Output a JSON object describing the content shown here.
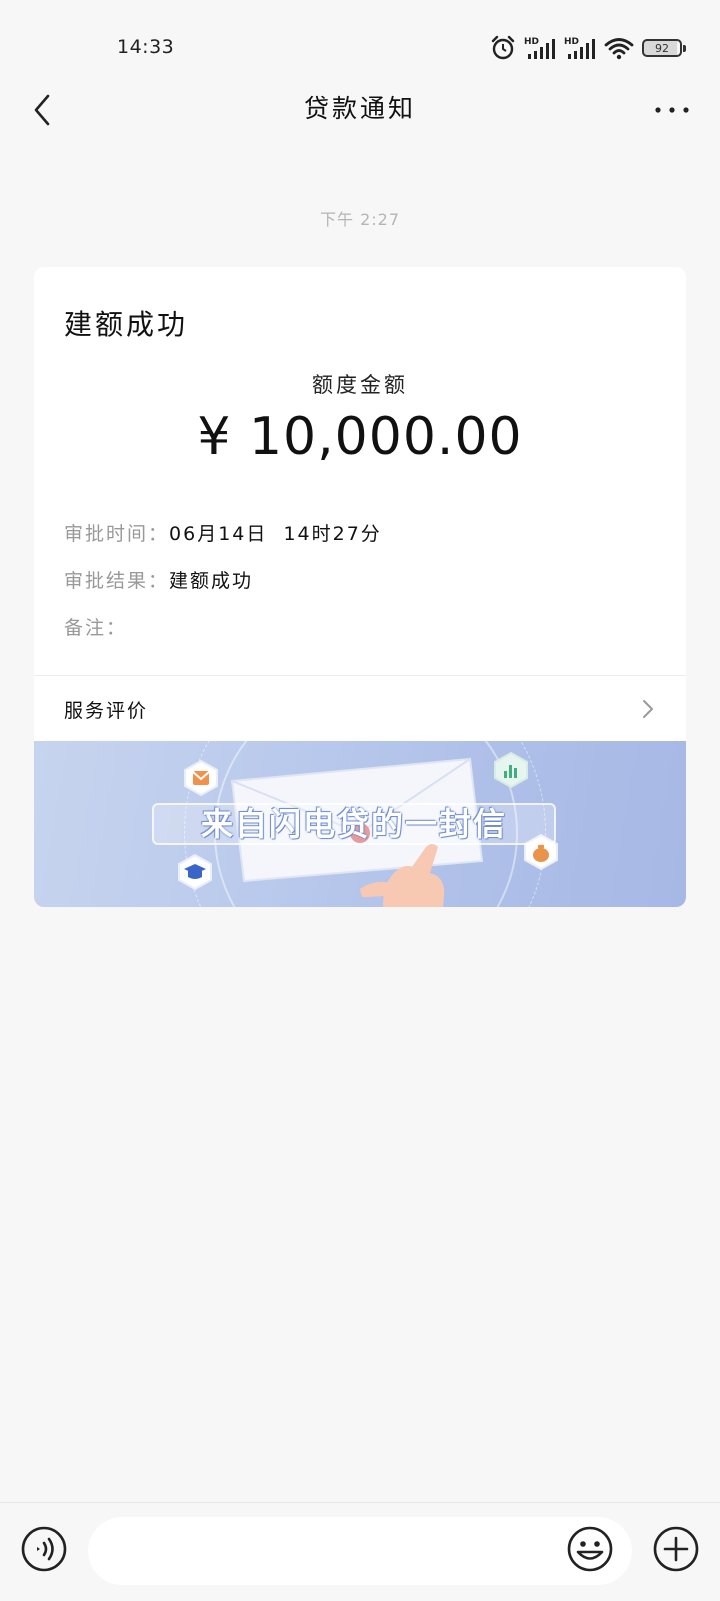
{
  "status_bar": {
    "time": "14:33",
    "battery": "92",
    "icons": [
      "alarm-icon",
      "hd-signal-icon",
      "hd-signal-icon",
      "wifi-icon",
      "battery-icon"
    ]
  },
  "nav": {
    "title": "贷款通知",
    "back_icon": "chevron-left-icon",
    "more_icon": "more-dots-icon"
  },
  "message": {
    "timestamp": "下午 2:27"
  },
  "card": {
    "title": "建额成功",
    "amount_label": "额度金额",
    "amount": "¥ 10,000.00",
    "rows": [
      {
        "key": "审批时间：",
        "value": "06月14日  14时27分"
      },
      {
        "key": "审批结果：",
        "value": "建额成功"
      },
      {
        "key": "备注：",
        "value": ""
      }
    ],
    "service_label": "服务评价"
  },
  "banner": {
    "text": "来自闪电贷的一封信"
  },
  "input_bar": {
    "placeholder": "",
    "icons": [
      "voice-icon",
      "emoji-icon",
      "plus-icon"
    ]
  },
  "colors": {
    "background": "#f7f7f7",
    "card": "#ffffff",
    "muted_text": "#999999",
    "banner_blue": "#b9c9ec"
  }
}
